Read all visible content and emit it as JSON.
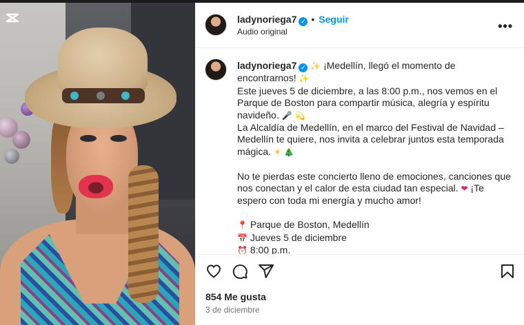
{
  "post": {
    "username": "ladynoriega7",
    "follow_label": "Seguir",
    "dot": "•",
    "audio_label": "Audio original",
    "more_label": "•••"
  },
  "caption": {
    "username": "ladynoriega7",
    "line1_text": "¡Medellín, llegó el momento de encontrarnos!",
    "line2_text": "Este jueves 5 de diciembre, a las 8:00 p.m., nos vemos en el Parque de Boston para compartir música, alegría y espíritu navideño.",
    "line3_text": "La Alcaldía de Medellín, en el marco del Festival de Navidad – Medellín te quiere, nos invita a celebrar juntos esta temporada mágica.",
    "line4_text": "No te pierdas este concierto lleno de emociones, canciones que nos conectan y el calor de esta ciudad tan especial.",
    "line4_tail": "¡Te espero con toda mi energía y mucho amor!",
    "location": "Parque de Boston, Medellín",
    "day": "Jueves 5 de diciembre",
    "time": "8:00 p.m."
  },
  "icons": {
    "sparkles": "✨",
    "microphone": "🎤",
    "dizzy": "💫",
    "sun": "☀",
    "tree": "🎄",
    "heart": "❤",
    "pin": "📍",
    "calendar": "📅",
    "clock": "⏰",
    "verified": "✓"
  },
  "footer": {
    "likes": "854 Me gusta",
    "date": "3 de diciembre"
  },
  "colors": {
    "accent": "#0095f6",
    "text": "#262626",
    "muted": "#737373",
    "heart": "#e0245e"
  }
}
